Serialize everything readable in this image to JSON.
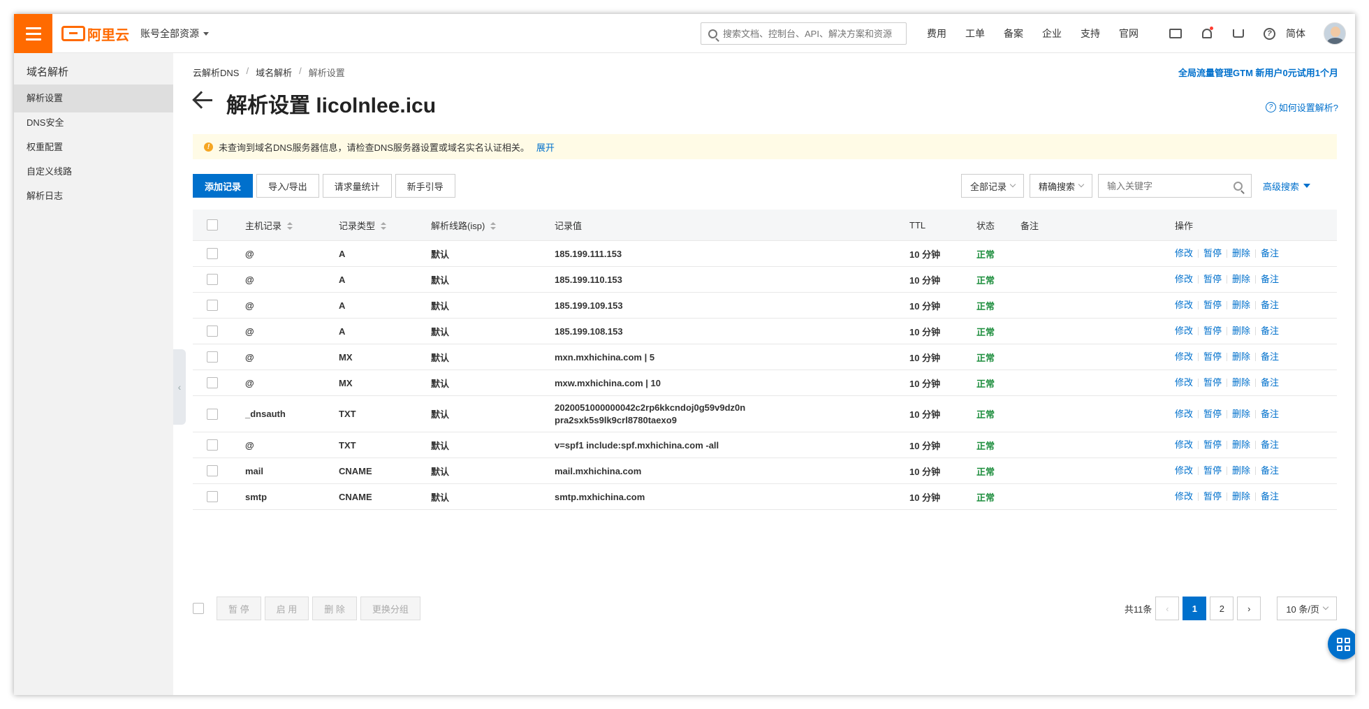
{
  "app": {
    "logo_text": "阿里云",
    "account_scope": "账号全部资源"
  },
  "topbar": {
    "search_placeholder": "搜索文档、控制台、API、解决方案和资源",
    "nav": [
      "费用",
      "工单",
      "备案",
      "企业",
      "支持",
      "官网"
    ],
    "icons": [
      "terminal-icon",
      "bell-icon",
      "cart-icon",
      "help-icon"
    ],
    "lang": "简体"
  },
  "sidebar": {
    "title": "域名解析",
    "items": [
      {
        "label": "解析设置",
        "active": true
      },
      {
        "label": "DNS安全"
      },
      {
        "label": "权重配置"
      },
      {
        "label": "自定义线路"
      },
      {
        "label": "解析日志"
      }
    ]
  },
  "breadcrumb": [
    "云解析DNS",
    "域名解析",
    "解析设置"
  ],
  "promo": "全局流量管理GTM 新用户0元试用1个月",
  "page_title": "解析设置 licolnlee.icu",
  "help_link": "如何设置解析?",
  "notice": {
    "text": "未查询到域名DNS服务器信息，请检查DNS服务器设置或域名实名认证相关。",
    "link": "展开"
  },
  "toolbar": {
    "add": "添加记录",
    "import": "导入/导出",
    "stats": "请求量统计",
    "guide": "新手引导"
  },
  "filters": {
    "records": "全部记录",
    "mode": "精确搜索",
    "keyword_placeholder": "输入关键字",
    "advanced": "高级搜索"
  },
  "table": {
    "headers": [
      "主机记录",
      "记录类型",
      "解析线路(isp)",
      "记录值",
      "TTL",
      "状态",
      "备注",
      "操作"
    ],
    "actions": [
      "修改",
      "暂停",
      "删除",
      "备注"
    ],
    "rows": [
      {
        "host": "@",
        "type": "A",
        "line": "默认",
        "value": "185.199.111.153",
        "ttl": "10 分钟",
        "status": "正常"
      },
      {
        "host": "@",
        "type": "A",
        "line": "默认",
        "value": "185.199.110.153",
        "ttl": "10 分钟",
        "status": "正常"
      },
      {
        "host": "@",
        "type": "A",
        "line": "默认",
        "value": "185.199.109.153",
        "ttl": "10 分钟",
        "status": "正常"
      },
      {
        "host": "@",
        "type": "A",
        "line": "默认",
        "value": "185.199.108.153",
        "ttl": "10 分钟",
        "status": "正常"
      },
      {
        "host": "@",
        "type": "MX",
        "line": "默认",
        "value": "mxn.mxhichina.com | 5",
        "ttl": "10 分钟",
        "status": "正常"
      },
      {
        "host": "@",
        "type": "MX",
        "line": "默认",
        "value": "mxw.mxhichina.com | 10",
        "ttl": "10 分钟",
        "status": "正常"
      },
      {
        "host": "_dnsauth",
        "type": "TXT",
        "line": "默认",
        "value": "2020051000000042c2rp6kkcndoj0g59v9dz0n",
        "value2": "pra2sxk5s9lk9crl8780taexo9",
        "ttl": "10 分钟",
        "status": "正常"
      },
      {
        "host": "@",
        "type": "TXT",
        "line": "默认",
        "value": "v=spf1 include:spf.mxhichina.com -all",
        "ttl": "10 分钟",
        "status": "正常"
      },
      {
        "host": "mail",
        "type": "CNAME",
        "line": "默认",
        "value": "mail.mxhichina.com",
        "ttl": "10 分钟",
        "status": "正常"
      },
      {
        "host": "smtp",
        "type": "CNAME",
        "line": "默认",
        "value": "smtp.mxhichina.com",
        "ttl": "10 分钟",
        "status": "正常"
      }
    ]
  },
  "footer": {
    "batch": [
      "暂 停",
      "启 用",
      "删 除",
      "更换分组"
    ],
    "total": "共11条",
    "pages": [
      "1",
      "2"
    ],
    "page_size": "10 条/页"
  },
  "colors": {
    "brand": "#ff6a00",
    "primary": "#0070cc",
    "status_ok": "#1e8e3e"
  }
}
